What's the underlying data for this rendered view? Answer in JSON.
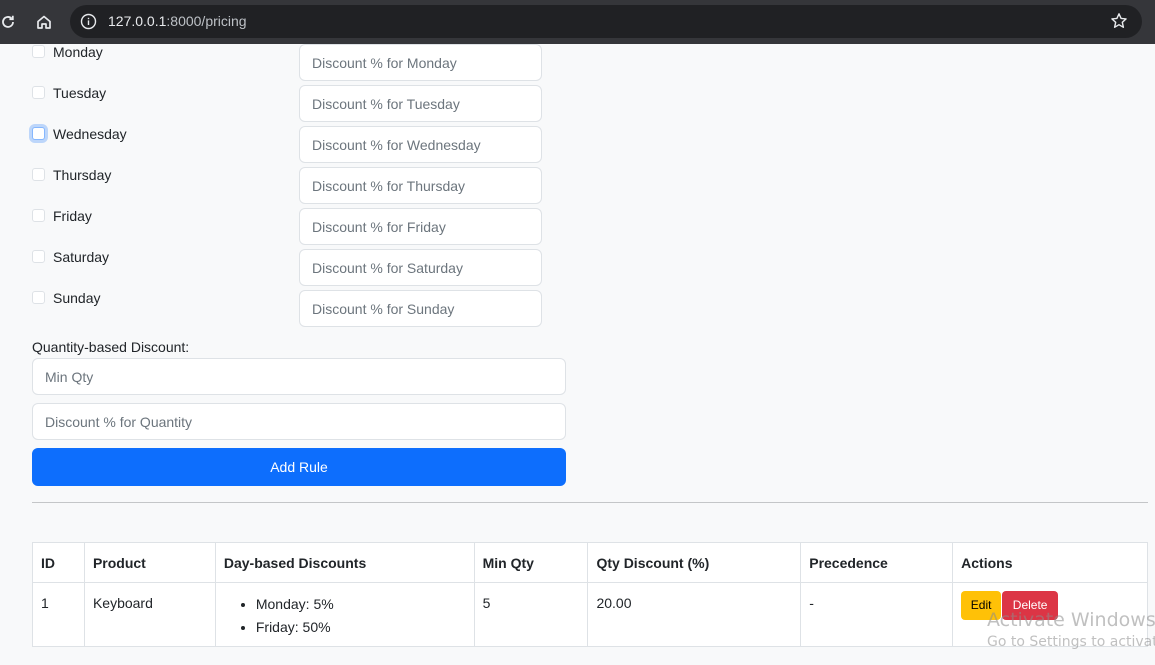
{
  "browser": {
    "url_host": "127.0.0.1",
    "url_rest": ":8000/pricing"
  },
  "days": [
    {
      "label": "Monday",
      "placeholder": "Discount % for Monday"
    },
    {
      "label": "Tuesday",
      "placeholder": "Discount % for Tuesday"
    },
    {
      "label": "Wednesday",
      "placeholder": "Discount % for Wednesday"
    },
    {
      "label": "Thursday",
      "placeholder": "Discount % for Thursday"
    },
    {
      "label": "Friday",
      "placeholder": "Discount % for Friday"
    },
    {
      "label": "Saturday",
      "placeholder": "Discount % for Saturday"
    },
    {
      "label": "Sunday",
      "placeholder": "Discount % for Sunday"
    }
  ],
  "quantity": {
    "heading": "Quantity-based Discount:",
    "min_qty_placeholder": "Min Qty",
    "discount_placeholder": "Discount % for Quantity"
  },
  "add_rule_label": "Add Rule",
  "table": {
    "headers": [
      "ID",
      "Product",
      "Day-based Discounts",
      "Min Qty",
      "Qty Discount (%)",
      "Precedence",
      "Actions"
    ],
    "rows": [
      {
        "id": "1",
        "product": "Keyboard",
        "day_discounts": [
          "Monday: 5%",
          "Friday: 50%"
        ],
        "min_qty": "5",
        "qty_discount": "20.00",
        "precedence": "-",
        "edit_label": "Edit",
        "delete_label": "Delete"
      }
    ]
  },
  "watermark": {
    "line1": "Activate Windows",
    "line2": "Go to Settings to activate"
  },
  "colors": {
    "primary": "#0d6efd",
    "warning": "#ffc107",
    "danger": "#dc3545"
  }
}
